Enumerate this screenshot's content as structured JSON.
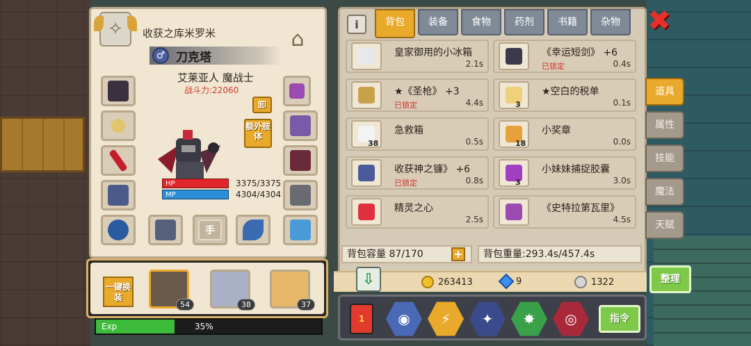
{
  "character": {
    "title": "收获之库米罗米",
    "name": "刀克塔",
    "race_class": "艾莱亚人 魔战士",
    "power": "战斗力:22060",
    "hp_label": "HP",
    "mp_label": "MP",
    "hp_value": "3375/3375",
    "mp_value": "4304/4304",
    "hand_slot": "手",
    "unequip_btn": "卸",
    "extra_limb_btn": "额外肢体"
  },
  "party": {
    "swap_btn": "一键换装",
    "members": [
      {
        "level": "54"
      },
      {
        "level": "38"
      },
      {
        "level": "37"
      }
    ]
  },
  "exp": {
    "label": "Exp",
    "percent": "35%",
    "fraction": 0.35
  },
  "tabs": [
    "背包",
    "装备",
    "食物",
    "药剂",
    "书籍",
    "杂物"
  ],
  "items": [
    {
      "name": "皇家御用的小冰箱",
      "weight": "2.1s",
      "locked": "",
      "qty": "",
      "icon": "fridge-icon",
      "color": "#e8e8ec"
    },
    {
      "name": "《幸运短剑》 +6",
      "weight": "0.4s",
      "locked": "已锁定",
      "qty": "",
      "icon": "dagger-icon",
      "color": "#3a3a4a"
    },
    {
      "name": "★《圣枪》 +3",
      "weight": "4.4s",
      "locked": "已锁定",
      "qty": "",
      "icon": "spear-icon",
      "color": "#c8a24a"
    },
    {
      "name": "★空白的税单",
      "weight": "0.1s",
      "locked": "",
      "qty": "3",
      "icon": "tax-form-icon",
      "color": "#f0d07a"
    },
    {
      "name": "急救箱",
      "weight": "0.5s",
      "locked": "",
      "qty": "38",
      "icon": "first-aid-icon",
      "color": "#f3f3f3"
    },
    {
      "name": "小奖章",
      "weight": "0.0s",
      "locked": "",
      "qty": "18",
      "icon": "medal-icon",
      "color": "#e8a03a"
    },
    {
      "name": "收获神之镰》 +6",
      "weight": "0.8s",
      "locked": "已锁定",
      "qty": "",
      "icon": "scythe-icon",
      "color": "#4a5a9a"
    },
    {
      "name": "小妹妹捕捉胶囊",
      "weight": "3.0s",
      "locked": "",
      "qty": "3",
      "icon": "capsule-icon",
      "color": "#a040c0"
    },
    {
      "name": "精灵之心",
      "weight": "2.5s",
      "locked": "",
      "qty": "",
      "icon": "heart-icon",
      "color": "#e03040"
    },
    {
      "name": "《史特拉第瓦里》",
      "weight": "4.5s",
      "locked": "",
      "qty": "",
      "icon": "violin-icon",
      "color": "#9a4ab0"
    }
  ],
  "capacity": "背包容量 87/170",
  "weight": "背包重量:293.4s/457.4s",
  "currency": {
    "gold": "263413",
    "gems": "9",
    "silver": "1322"
  },
  "side_tabs": [
    "道具",
    "属性",
    "技能",
    "魔法",
    "天赋"
  ],
  "sort_btn": "整理",
  "command_btn": "指令"
}
